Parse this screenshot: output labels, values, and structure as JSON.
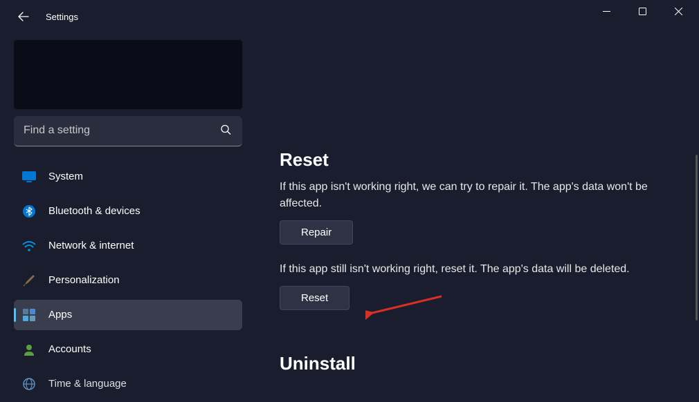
{
  "window": {
    "title": "Settings"
  },
  "search": {
    "placeholder": "Find a setting"
  },
  "sidebar": {
    "items": [
      {
        "key": "system",
        "label": "System"
      },
      {
        "key": "bluetooth",
        "label": "Bluetooth & devices"
      },
      {
        "key": "network",
        "label": "Network & internet"
      },
      {
        "key": "personalization",
        "label": "Personalization"
      },
      {
        "key": "apps",
        "label": "Apps"
      },
      {
        "key": "accounts",
        "label": "Accounts"
      },
      {
        "key": "time",
        "label": "Time & language"
      }
    ]
  },
  "main": {
    "reset": {
      "heading": "Reset",
      "repair_text": "If this app isn't working right, we can try to repair it. The app's data won't be affected.",
      "repair_button": "Repair",
      "reset_text": "If this app still isn't working right, reset it. The app's data will be deleted.",
      "reset_button": "Reset"
    },
    "uninstall": {
      "heading": "Uninstall"
    }
  }
}
